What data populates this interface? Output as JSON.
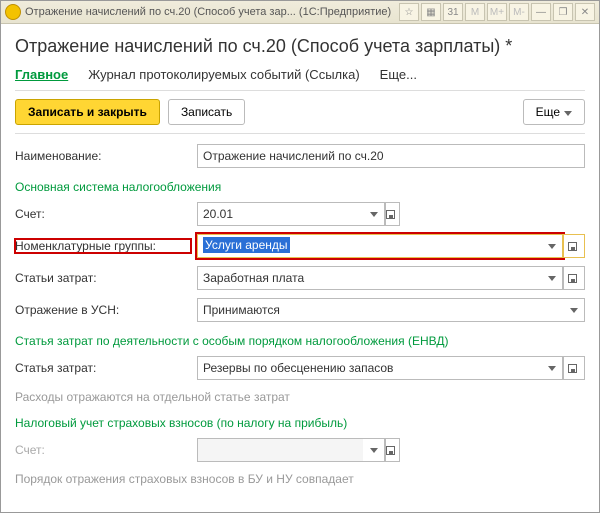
{
  "titlebar": {
    "title": "Отражение начислений по сч.20 (Способ учета зар...  (1С:Предприятие)",
    "btn_star": "☆",
    "btn_calc": "▦",
    "btn_cal": "31",
    "btn_m": "M",
    "btn_mplus": "M+",
    "btn_mminus": "M-",
    "btn_min": "—",
    "btn_max": "❐",
    "btn_close": "✕"
  },
  "header": "Отражение начислений по сч.20 (Способ учета зарплаты) *",
  "tabs": {
    "main": "Главное",
    "journal": "Журнал протоколируемых событий (Ссылка)",
    "more": "Еще..."
  },
  "cmd": {
    "write_close": "Записать и закрыть",
    "write": "Записать",
    "more": "Еще"
  },
  "labels": {
    "name": "Наименование:",
    "tax_section": "Основная система налогообложения",
    "account": "Счет:",
    "nomgroups": "Номенклатурные группы:",
    "cost_items": "Статьи затрат:",
    "usn": "Отражение в УСН:",
    "envd_section": "Статья затрат по деятельности с особым порядком налогообложения (ЕНВД)",
    "cost_item2": "Статья затрат:",
    "envd_hint": "Расходы отражаются на отдельной статье затрат",
    "ins_section": "Налоговый учет страховых взносов (по налогу на прибыль)",
    "account2": "Счет:",
    "ins_hint": "Порядок отражения страховых взносов в БУ и НУ совпадает"
  },
  "values": {
    "name": "Отражение начислений по сч.20",
    "account": "20.01",
    "nomgroups": "Услуги аренды",
    "cost_items": "Заработная плата",
    "usn": "Принимаются",
    "cost_item2": "Резервы по обесценению запасов",
    "account2": ""
  }
}
